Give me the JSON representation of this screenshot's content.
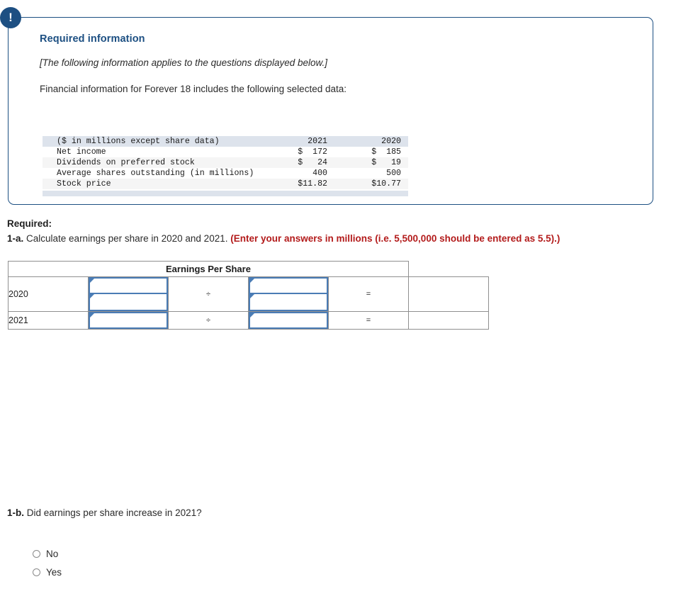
{
  "panel": {
    "badge_icon": "exclamation-icon",
    "badge_text": "!",
    "title": "Required information",
    "italic_note": "[The following information applies to the questions displayed below.]",
    "lead_text": "Financial information for Forever 18 includes the following selected data:"
  },
  "financial_table": {
    "header": [
      "($ in millions except share data)",
      "2021",
      "2020"
    ],
    "rows": [
      {
        "label": "Net income",
        "v2021": "$  172",
        "v2020": "$  185"
      },
      {
        "label": "Dividends on preferred stock",
        "v2021": "$   24",
        "v2020": "$   19"
      },
      {
        "label": "Average shares outstanding (in millions)",
        "v2021": "400",
        "v2020": "500"
      },
      {
        "label": "Stock price",
        "v2021": "$11.82",
        "v2020": "$10.77"
      }
    ]
  },
  "required": {
    "label": "Required:",
    "q1a_num": "1-a.",
    "q1a_text": " Calculate earnings per share in 2020 and 2021. ",
    "q1a_note": "(Enter your answers in millions (i.e. 5,500,000 should be entered as 5.5).)"
  },
  "eps_table": {
    "header": "Earnings Per Share",
    "divide_symbol": "÷",
    "equals_symbol": "=",
    "rows": [
      {
        "year": "2020",
        "numerator_fields": [
          "",
          ""
        ],
        "denominator_fields": [
          "",
          ""
        ],
        "result": ""
      },
      {
        "year": "2021",
        "numerator_fields": [
          ""
        ],
        "denominator_fields": [
          ""
        ],
        "result": ""
      }
    ]
  },
  "question_1b": {
    "num": "1-b.",
    "text": " Did earnings per share increase in 2021?",
    "options": [
      {
        "label": "No",
        "selected": false
      },
      {
        "label": "Yes",
        "selected": false
      }
    ]
  },
  "colors": {
    "panel_border": "#1c4f82",
    "badge_bg": "#1d4f82",
    "title_blue": "#1c4f82",
    "eps_header_blue": "#7dacdd",
    "result_yellow": "#fbf8b9",
    "input_border": "#4a7cb5",
    "note_red": "#b31b1b",
    "fin_header_bg": "#dde3ec"
  }
}
